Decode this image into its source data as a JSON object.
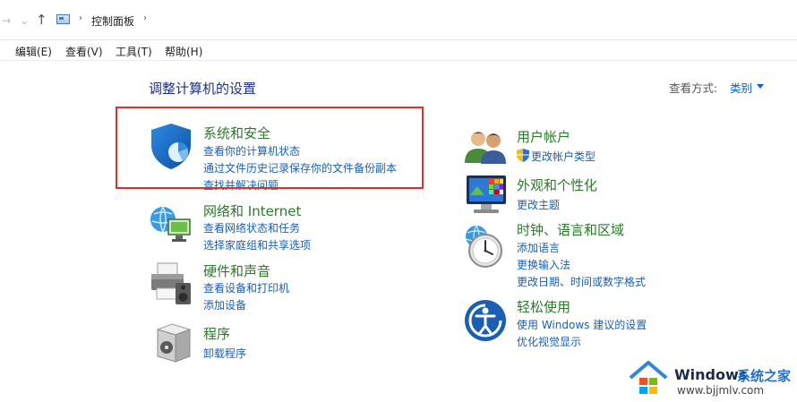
{
  "addressbar": {
    "back_icon": "→",
    "dropdown_icon": "⌄",
    "up_icon": "↑",
    "sep_icon": "›",
    "crumb": "控制面板",
    "crumb_sep": "›"
  },
  "menubar": {
    "items": [
      "编辑(E)",
      "查看(V)",
      "工具(T)",
      "帮助(H)"
    ]
  },
  "main": {
    "title": "调整计算机的设置",
    "view_by_label": "查看方式:",
    "view_by_value": "类别"
  },
  "left_categories": [
    {
      "title": "系统和安全",
      "links": [
        "查看你的计算机状态",
        "通过文件历史记录保存你的文件备份副本",
        "查找并解决问题"
      ],
      "icon": "shield-icon"
    },
    {
      "title": "网络和 Internet",
      "links": [
        "查看网络状态和任务",
        "选择家庭组和共享选项"
      ],
      "icon": "network-globe-icon"
    },
    {
      "title": "硬件和声音",
      "links": [
        "查看设备和打印机",
        "添加设备"
      ],
      "icon": "printer-speaker-icon"
    },
    {
      "title": "程序",
      "links": [
        "卸载程序"
      ],
      "icon": "programs-box-icon"
    }
  ],
  "right_categories": [
    {
      "title": "用户帐户",
      "links": [
        "更改帐户类型"
      ],
      "icon": "users-icon"
    },
    {
      "title": "外观和个性化",
      "links": [
        "更改主题"
      ],
      "icon": "monitor-palette-icon"
    },
    {
      "title": "时钟、语言和区域",
      "links": [
        "添加语言",
        "更换输入法",
        "更改日期、时间或数字格式"
      ],
      "icon": "clock-globe-icon"
    },
    {
      "title": "轻松使用",
      "links": [
        "使用 Windows 建议的设置",
        "优化视觉显示"
      ],
      "icon": "ease-of-access-icon"
    }
  ],
  "watermark": {
    "title": "Windows",
    "title_cn": "系统之家",
    "url": "www.bjjmlv.com"
  },
  "colors": {
    "category_title": "#2a7a2a",
    "link": "#1a5fb4",
    "page_title": "#1e3287",
    "highlight_box": "#d93131"
  }
}
